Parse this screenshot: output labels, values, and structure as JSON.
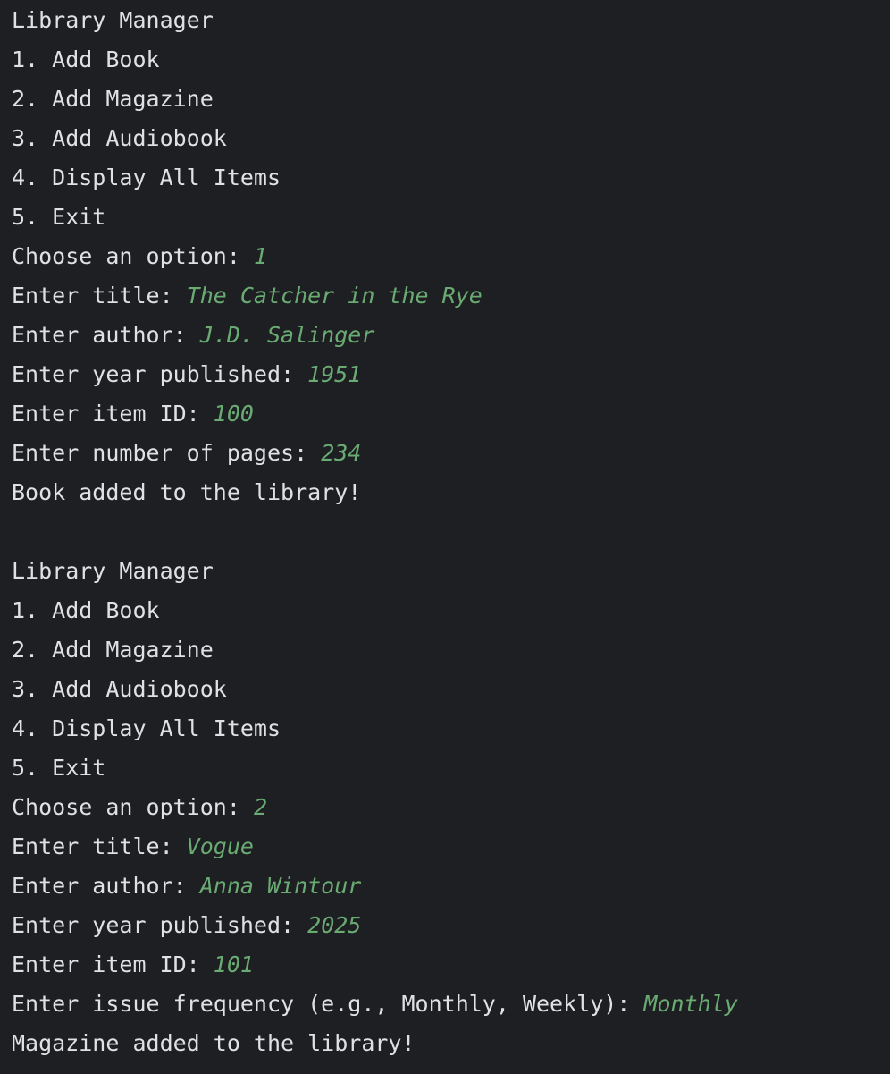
{
  "console": {
    "lines": [
      {
        "prompt": "Library Manager",
        "input": ""
      },
      {
        "prompt": "1. Add Book",
        "input": ""
      },
      {
        "prompt": "2. Add Magazine",
        "input": ""
      },
      {
        "prompt": "3. Add Audiobook",
        "input": ""
      },
      {
        "prompt": "4. Display All Items",
        "input": ""
      },
      {
        "prompt": "5. Exit",
        "input": ""
      },
      {
        "prompt": "Choose an option: ",
        "input": "1"
      },
      {
        "prompt": "Enter title: ",
        "input": "The Catcher in the Rye"
      },
      {
        "prompt": "Enter author: ",
        "input": "J.D. Salinger"
      },
      {
        "prompt": "Enter year published: ",
        "input": "1951"
      },
      {
        "prompt": "Enter item ID: ",
        "input": "100"
      },
      {
        "prompt": "Enter number of pages: ",
        "input": "234"
      },
      {
        "prompt": "Book added to the library!",
        "input": ""
      },
      {
        "prompt": "",
        "input": ""
      },
      {
        "prompt": "Library Manager",
        "input": ""
      },
      {
        "prompt": "1. Add Book",
        "input": ""
      },
      {
        "prompt": "2. Add Magazine",
        "input": ""
      },
      {
        "prompt": "3. Add Audiobook",
        "input": ""
      },
      {
        "prompt": "4. Display All Items",
        "input": ""
      },
      {
        "prompt": "5. Exit",
        "input": ""
      },
      {
        "prompt": "Choose an option: ",
        "input": "2"
      },
      {
        "prompt": "Enter title: ",
        "input": "Vogue"
      },
      {
        "prompt": "Enter author: ",
        "input": "Anna Wintour"
      },
      {
        "prompt": "Enter year published: ",
        "input": "2025"
      },
      {
        "prompt": "Enter item ID: ",
        "input": "101"
      },
      {
        "prompt": "Enter issue frequency (e.g., Monthly, Weekly): ",
        "input": "Monthly"
      },
      {
        "prompt": "Magazine added to the library!",
        "input": ""
      }
    ]
  },
  "colors": {
    "background": "#1e1f22",
    "output_text": "#dfe1e5",
    "user_input": "#6aab73"
  }
}
